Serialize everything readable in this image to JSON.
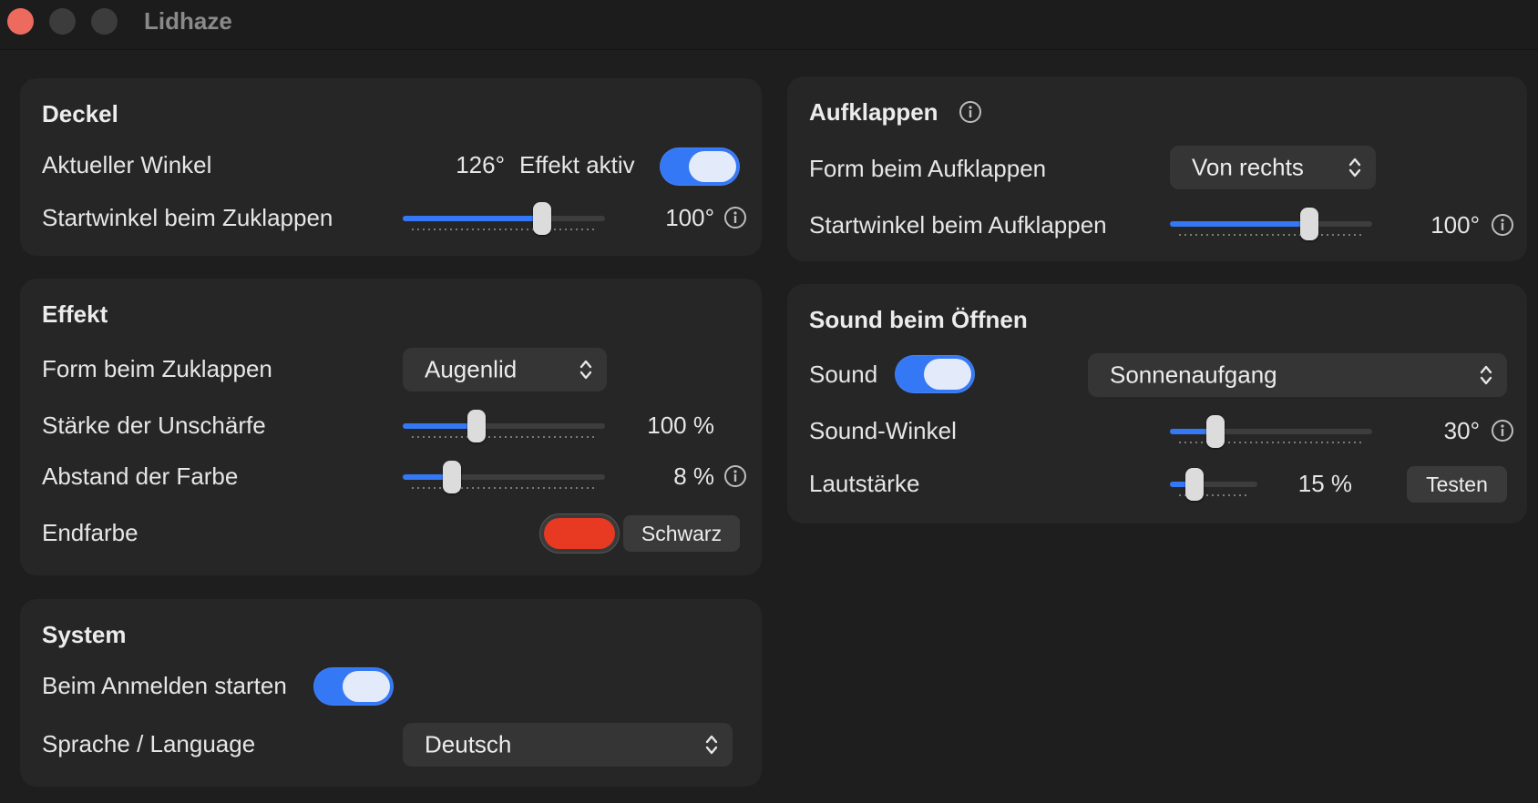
{
  "window": {
    "title": "Lidhaze"
  },
  "colors": {
    "accent": "#3478f6",
    "end_color": "#e83a22"
  },
  "deckel": {
    "heading": "Deckel",
    "current_angle_label": "Aktueller Winkel",
    "current_angle_value": "126°",
    "effect_active_label": "Effekt aktiv",
    "effect_active_on": true,
    "start_angle_label": "Startwinkel beim Zuklappen",
    "start_angle_value": "100°",
    "start_angle_fraction": 0.71
  },
  "effekt": {
    "heading": "Effekt",
    "shape_label": "Form beim Zuklappen",
    "shape_value": "Augenlid",
    "blur_label": "Stärke der Unschärfe",
    "blur_value": "100 %",
    "blur_fraction": 0.35,
    "color_distance_label": "Abstand der Farbe",
    "color_distance_value": "8 %",
    "color_distance_fraction": 0.22,
    "end_color_label": "Endfarbe",
    "black_button": "Schwarz"
  },
  "system": {
    "heading": "System",
    "login_label": "Beim Anmelden starten",
    "login_on": true,
    "language_label": "Sprache / Language",
    "language_value": "Deutsch"
  },
  "aufklappen": {
    "heading": "Aufklappen",
    "shape_label": "Form beim Aufklappen",
    "shape_value": "Von rechts",
    "start_angle_label": "Startwinkel beim Aufklappen",
    "start_angle_value": "100°",
    "start_angle_fraction": 0.71
  },
  "sound": {
    "heading": "Sound beim Öffnen",
    "sound_label": "Sound",
    "sound_on": true,
    "sound_value": "Sonnenaufgang",
    "angle_label": "Sound-Winkel",
    "angle_value": "30°",
    "angle_fraction": 0.2,
    "volume_label": "Lautstärke",
    "volume_value": "15 %",
    "volume_fraction": 0.22,
    "test_button": "Testen"
  }
}
